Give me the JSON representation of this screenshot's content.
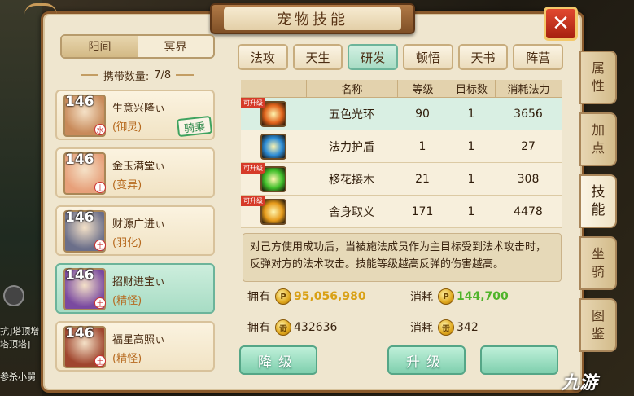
{
  "window": {
    "title": "宠物技能",
    "close_label": "✕"
  },
  "background_text": [
    "抗]塔顶增",
    "塔顶塔]",
    "参杀小舅"
  ],
  "realm_tabs": [
    {
      "label": "阳间",
      "active": true
    },
    {
      "label": "冥界",
      "active": false
    }
  ],
  "carry": {
    "label": "携带数量:",
    "value": "7/8"
  },
  "pets": [
    {
      "level": "146",
      "name": "生意兴隆ぃ",
      "type": "(御灵)",
      "element": "水",
      "mounted": true,
      "mount_label": "骑乘",
      "selected": false,
      "avatar_color": "#c88a5a"
    },
    {
      "level": "146",
      "name": "金玉满堂ぃ",
      "type": "(变异)",
      "element": "土",
      "mounted": false,
      "selected": false,
      "avatar_color": "#e7a07a"
    },
    {
      "level": "146",
      "name": "财源广进ぃ",
      "type": "(羽化)",
      "element": "土",
      "mounted": false,
      "selected": false,
      "avatar_color": "#6b6f8a"
    },
    {
      "level": "146",
      "name": "招财进宝ぃ",
      "type": "(精怪)",
      "element": "土",
      "mounted": false,
      "selected": true,
      "avatar_color": "#7a4aa0"
    },
    {
      "level": "146",
      "name": "福星高照ぃ",
      "type": "(精怪)",
      "element": "土",
      "mounted": false,
      "selected": false,
      "avatar_color": "#a0462e"
    }
  ],
  "skill_tabs": [
    {
      "label": "法攻",
      "active": false
    },
    {
      "label": "天生",
      "active": false
    },
    {
      "label": "研发",
      "active": true
    },
    {
      "label": "顿悟",
      "active": false
    },
    {
      "label": "天书",
      "active": false
    },
    {
      "label": "阵营",
      "active": false
    }
  ],
  "table": {
    "headers": [
      "名称",
      "等级",
      "目标数",
      "消耗法力"
    ],
    "rows": [
      {
        "name": "五色光环",
        "level": "90",
        "targets": "1",
        "cost": "3656",
        "upgradable": true,
        "upgradable_label": "可升级",
        "selected": true,
        "icon_color": "#e1641c",
        "icon_name": "five-color-halo-icon"
      },
      {
        "name": "法力护盾",
        "level": "1",
        "targets": "1",
        "cost": "27",
        "upgradable": false,
        "selected": false,
        "icon_color": "#2a8ad6",
        "icon_name": "mana-shield-icon"
      },
      {
        "name": "移花接木",
        "level": "21",
        "targets": "1",
        "cost": "308",
        "upgradable": true,
        "upgradable_label": "可升级",
        "selected": false,
        "icon_color": "#3fbf2a",
        "icon_name": "graft-flower-icon"
      },
      {
        "name": "舍身取义",
        "level": "171",
        "targets": "1",
        "cost": "4478",
        "upgradable": true,
        "upgradable_label": "可升级",
        "selected": false,
        "icon_color": "#e69a1a",
        "icon_name": "self-sacrifice-icon"
      }
    ]
  },
  "description": "对己方使用成功后，当被施法成员作为主目标受到法术攻击时，反弹对方的法术攻击。技能等级越高反弹的伤害越高。",
  "resources": {
    "own_label": "拥有",
    "cost_label": "消耗",
    "own_gold": "95,056,980",
    "cost_gold": "144,700",
    "own_contrib": "432636",
    "cost_contrib": "342",
    "gold_icon_glyph": "P",
    "contrib_icon_glyph": "贡"
  },
  "buttons": {
    "downgrade": "降级",
    "upgrade": "升级",
    "third": ""
  },
  "side_tabs": [
    {
      "label": "属性",
      "active": false
    },
    {
      "label": "加点",
      "active": false
    },
    {
      "label": "技能",
      "active": true
    },
    {
      "label": "坐骑",
      "active": false
    },
    {
      "label": "图鉴",
      "active": false
    }
  ],
  "watermark": "九游",
  "colors": {
    "gold_value": "#d9a116",
    "green_value": "#4fb42a",
    "selected_row": "#d9efe3",
    "frame": "#8a5a2c"
  }
}
